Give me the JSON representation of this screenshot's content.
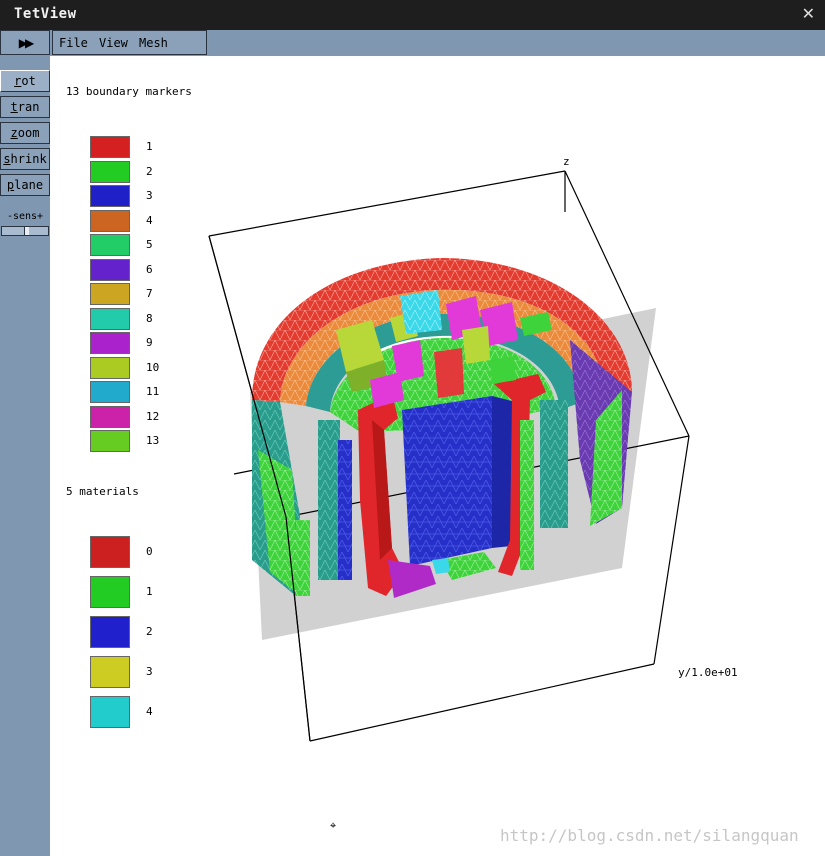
{
  "window": {
    "title": "TetView",
    "close_glyph": "✕"
  },
  "toolbar": {
    "play_glyph": "▶▶",
    "menu": [
      "File",
      "View",
      "Mesh"
    ]
  },
  "tools": [
    {
      "first": "r",
      "rest": "ot"
    },
    {
      "first": "t",
      "rest": "ran"
    },
    {
      "first": "z",
      "rest": "oom"
    },
    {
      "first": "s",
      "rest": "hrink"
    },
    {
      "first": "p",
      "rest": "lane"
    }
  ],
  "sens_label": "-sens+",
  "boundary_legend": {
    "title": "13 boundary markers",
    "items": [
      {
        "label": "1",
        "color": "#d42020"
      },
      {
        "label": "2",
        "color": "#22cc22"
      },
      {
        "label": "3",
        "color": "#2020c8"
      },
      {
        "label": "4",
        "color": "#cc6422"
      },
      {
        "label": "5",
        "color": "#22cc66"
      },
      {
        "label": "6",
        "color": "#6422cc"
      },
      {
        "label": "7",
        "color": "#cca622"
      },
      {
        "label": "8",
        "color": "#22ccaa"
      },
      {
        "label": "9",
        "color": "#aa22cc"
      },
      {
        "label": "10",
        "color": "#aacc22"
      },
      {
        "label": "11",
        "color": "#22aacc"
      },
      {
        "label": "12",
        "color": "#cc22aa"
      },
      {
        "label": "13",
        "color": "#66cc22"
      }
    ]
  },
  "material_legend": {
    "title": "5 materials",
    "items": [
      {
        "label": "0",
        "color": "#cc2020"
      },
      {
        "label": "1",
        "color": "#22cc22"
      },
      {
        "label": "2",
        "color": "#2020cc"
      },
      {
        "label": "3",
        "color": "#cccc22"
      },
      {
        "label": "4",
        "color": "#22cccc"
      }
    ]
  },
  "axes": {
    "z_label": "z",
    "y_label": "y/1.0e+01"
  },
  "watermark": "http://blog.csdn.net/silangquan",
  "cursor_glyph": "⌖"
}
